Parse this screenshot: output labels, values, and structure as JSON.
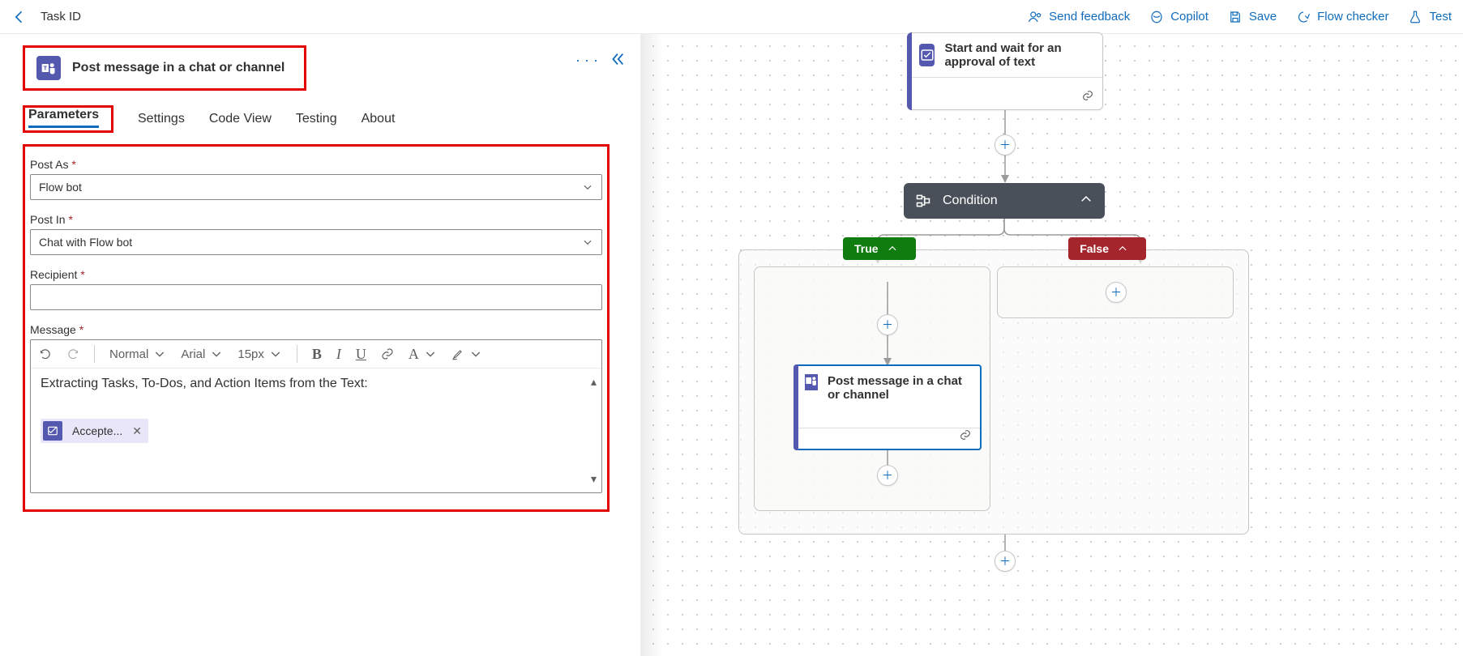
{
  "header": {
    "breadcrumb": "Task ID",
    "actions": {
      "feedback": "Send feedback",
      "copilot": "Copilot",
      "save": "Save",
      "checker": "Flow checker",
      "test": "Test"
    }
  },
  "panel": {
    "title": "Post message in a chat or channel",
    "tabs": [
      "Parameters",
      "Settings",
      "Code View",
      "Testing",
      "About"
    ],
    "active_tab": 0,
    "fields": {
      "post_as": {
        "label": "Post As",
        "value": "Flow bot",
        "required": true
      },
      "post_in": {
        "label": "Post In",
        "value": "Chat with Flow bot",
        "required": true
      },
      "recipient": {
        "label": "Recipient",
        "value": "",
        "required": true
      },
      "message": {
        "label": "Message",
        "required": true
      }
    },
    "rte_toolbar": {
      "style": "Normal",
      "font": "Arial",
      "size": "15px"
    },
    "message_body": {
      "text": "Extracting Tasks, To-Dos, and Action Items from the Text:",
      "token": "Accepte..."
    }
  },
  "canvas": {
    "approval": {
      "title": "Start and wait for an approval of text"
    },
    "condition": {
      "title": "Condition"
    },
    "branches": {
      "true": "True",
      "false": "False"
    },
    "post_node": {
      "title": "Post message in a chat or channel"
    }
  }
}
